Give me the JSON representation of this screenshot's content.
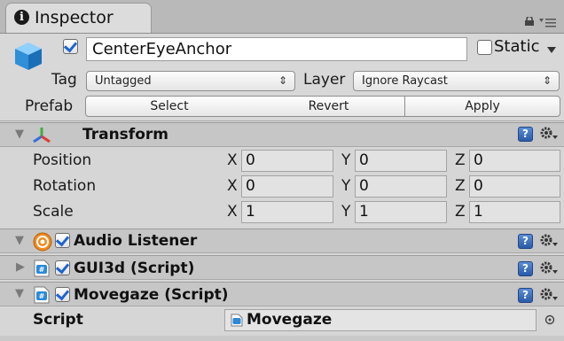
{
  "tab": {
    "title": "Inspector"
  },
  "object": {
    "name": "CenterEyeAnchor",
    "active": true,
    "static_label": "Static",
    "static_checked": false,
    "tag_label": "Tag",
    "tag_value": "Untagged",
    "layer_label": "Layer",
    "layer_value": "Ignore Raycast",
    "prefab_label": "Prefab",
    "prefab_buttons": {
      "select": "Select",
      "revert": "Revert",
      "apply": "Apply"
    }
  },
  "transform": {
    "title": "Transform",
    "rows": [
      {
        "label": "Position",
        "x": "0",
        "y": "0",
        "z": "0"
      },
      {
        "label": "Rotation",
        "x": "0",
        "y": "0",
        "z": "0"
      },
      {
        "label": "Scale",
        "x": "1",
        "y": "1",
        "z": "1"
      }
    ],
    "axis_labels": {
      "x": "X",
      "y": "Y",
      "z": "Z"
    }
  },
  "components": [
    {
      "title": "Audio Listener",
      "enabled": true,
      "expanded": true
    },
    {
      "title": "GUI3d (Script)",
      "enabled": true,
      "expanded": false
    },
    {
      "title": "Movegaze (Script)",
      "enabled": true,
      "expanded": true
    }
  ],
  "script": {
    "label": "Script",
    "value": "Movegaze"
  },
  "colors": {
    "accent_blue": "#1e64d0",
    "header_bg": "#c6c6c6",
    "panel_bg": "#d6d6d6"
  },
  "icons": {
    "tab": "info-icon",
    "lock": "lock-icon",
    "menu": "menu-icon",
    "object": "cube-icon",
    "transform": "transform-axes-icon",
    "audio": "audio-listener-icon",
    "script": "csharp-script-icon",
    "help": "help-icon",
    "gear": "gear-icon"
  }
}
